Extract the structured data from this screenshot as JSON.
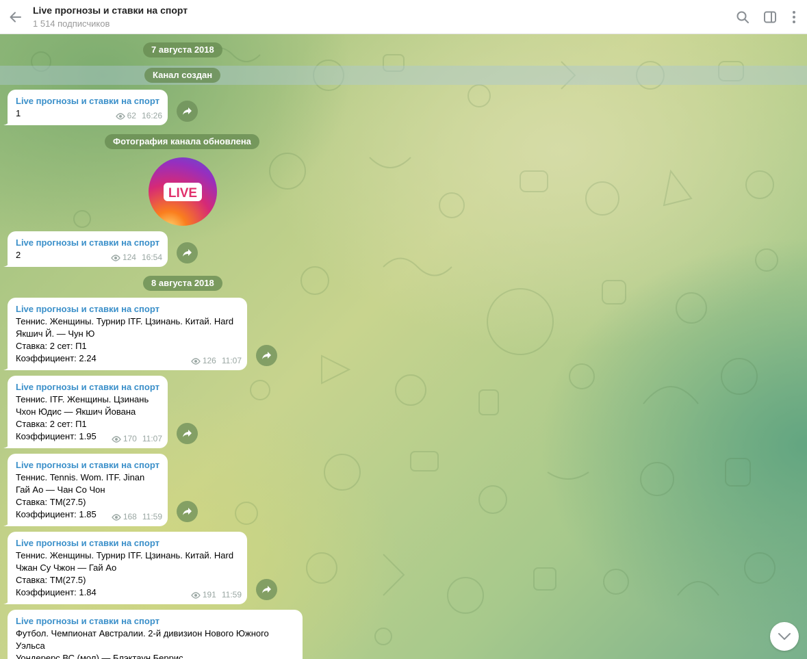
{
  "header": {
    "title": "Live прогнозы и ставки на спорт",
    "subscribers": "1 514 подписчиков"
  },
  "icons": {
    "back": "arrow-left-icon",
    "search": "search-icon",
    "sidebar": "sidebar-panel-icon",
    "menu": "more-vertical-icon",
    "views": "eye-icon",
    "share": "share-arrow-icon",
    "scroll_down": "chevron-down-icon"
  },
  "colors": {
    "author": "#3a8fc9",
    "service_bg": "#688c52",
    "avatar_gradient": [
      "#5b5bd6",
      "#d62976",
      "#fa7e1e",
      "#feda75"
    ]
  },
  "service_messages": {
    "date1": "7 августа 2018",
    "created": "Канал создан",
    "photo_updated": "Фотография канала обновлена",
    "date2": "8 августа 2018"
  },
  "avatar": {
    "badge_text": "LIVE"
  },
  "messages": [
    {
      "author": "Live прогнозы и ставки на спорт",
      "lines": [
        "1"
      ],
      "views": "62",
      "time": "16:26"
    },
    {
      "author": "Live прогнозы и ставки на спорт",
      "lines": [
        "2"
      ],
      "views": "124",
      "time": "16:54"
    },
    {
      "author": "Live прогнозы и ставки на спорт",
      "lines": [
        "Теннис. Женщины. Турнир ITF. Цзинань. Китай. Hard",
        "Якшич Й. — Чун Ю",
        "Ставка: 2 сет: П1",
        "Коэффициент: 2.24"
      ],
      "views": "126",
      "time": "11:07"
    },
    {
      "author": "Live прогнозы и ставки на спорт",
      "lines": [
        "Теннис. ITF. Женщины. Цзинань",
        "Чхон Юдис — Якшич Йована",
        "Ставка: 2 сет: П1",
        "Коэффициент: 1.95"
      ],
      "views": "170",
      "time": "11:07"
    },
    {
      "author": "Live прогнозы и ставки на спорт",
      "lines": [
        "Теннис. Tennis. Wom. ITF. Jinan",
        "Гай Ао — Чан Со Чон",
        "Ставка: ТМ(27.5)",
        "Коэффициент: 1.85"
      ],
      "views": "168",
      "time": "11:59"
    },
    {
      "author": "Live прогнозы и ставки на спорт",
      "lines": [
        "Теннис. Женщины. Турнир ITF. Цзинань. Китай. Hard",
        "Чжан Су Чжон — Гай Ао",
        "Ставка: ТМ(27.5)",
        "Коэффициент: 1.84"
      ],
      "views": "191",
      "time": "11:59"
    },
    {
      "author": "Live прогнозы и ставки на спорт",
      "lines": [
        "Футбол. Чемпионат Австралии. 2-й дивизион Нового Южного",
        "Уэльса",
        "Уондерерс ВС (мол) — Блэктаун Беррис"
      ],
      "views": "",
      "time": ""
    }
  ]
}
